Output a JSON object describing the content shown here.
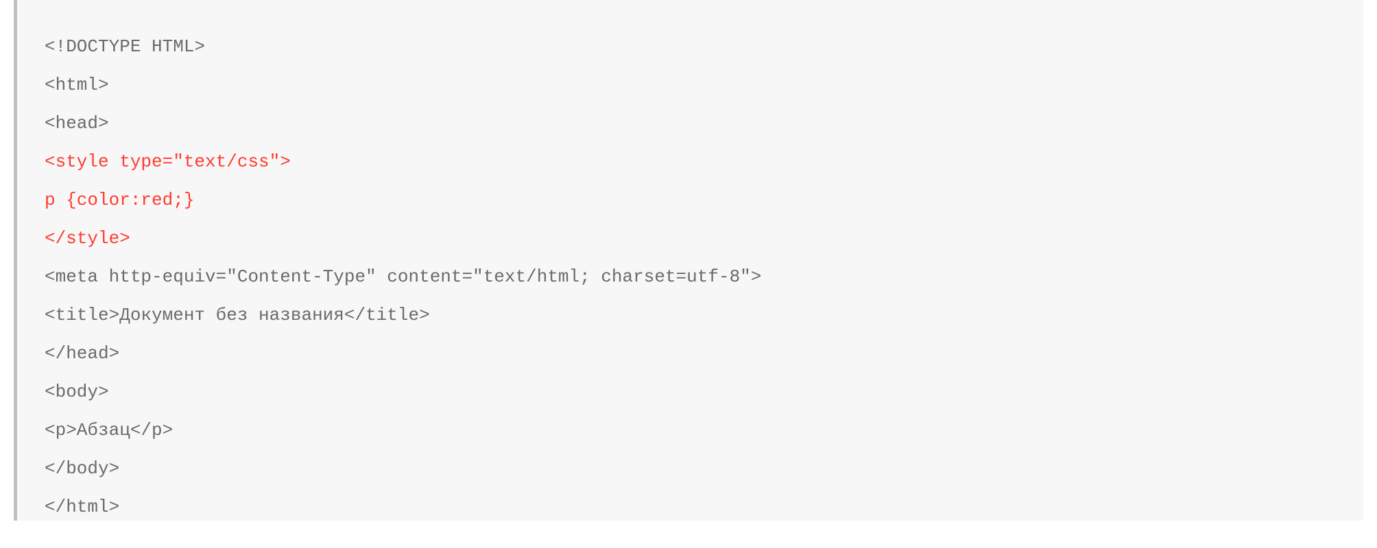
{
  "code": {
    "lines": [
      {
        "text": "<!DOCTYPE HTML>",
        "highlight": false
      },
      {
        "text": "<html>",
        "highlight": false
      },
      {
        "text": "<head>",
        "highlight": false
      },
      {
        "text": "<style type=\"text/css\">",
        "highlight": true
      },
      {
        "text": "p {color:red;}",
        "highlight": true
      },
      {
        "text": "</style>",
        "highlight": true
      },
      {
        "text": "<meta http-equiv=\"Content-Type\" content=\"text/html; charset=utf-8\">",
        "highlight": false
      },
      {
        "text": "<title>Документ без названия</title>",
        "highlight": false
      },
      {
        "text": "</head>",
        "highlight": false
      },
      {
        "text": "<body>",
        "highlight": false
      },
      {
        "text": "<p>Абзац</p>",
        "highlight": false
      },
      {
        "text": "</body>",
        "highlight": false
      },
      {
        "text": "</html>",
        "highlight": false
      }
    ]
  }
}
